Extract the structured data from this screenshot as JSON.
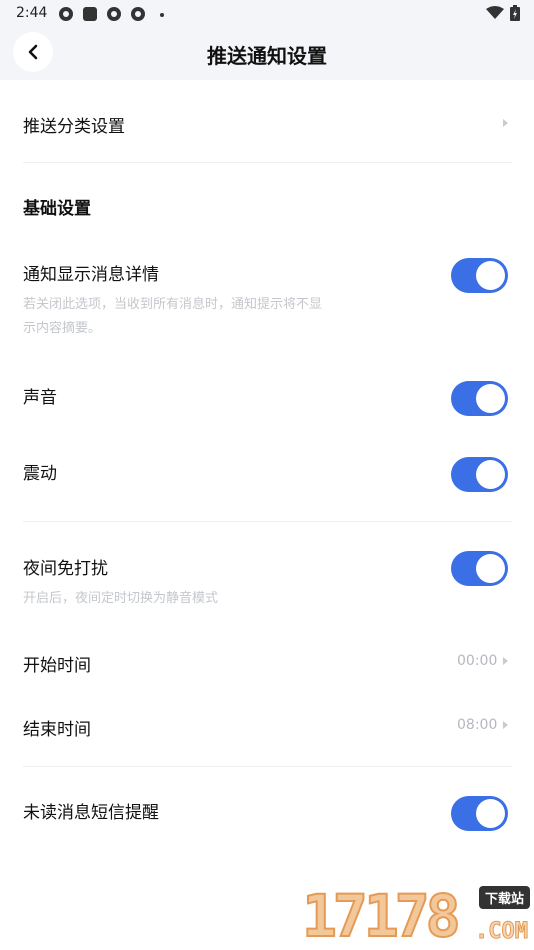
{
  "status_bar": {
    "time": "2:44",
    "icons": [
      "settings-gear-icon",
      "square-app-icon",
      "settings-gear-icon",
      "settings-gear-icon",
      "dot-icon"
    ],
    "right_icons": [
      "wifi-icon",
      "battery-charging-icon"
    ]
  },
  "header": {
    "title": "推送通知设置",
    "back_icon": "chevron-left-icon"
  },
  "rows": {
    "push_category": {
      "label": "推送分类设置"
    },
    "basic_section": {
      "title": "基础设置"
    },
    "show_details": {
      "label": "通知显示消息详情",
      "description": "若关闭此选项，当收到所有消息时，通知提示将不显示内容摘要。",
      "enabled": true
    },
    "sound": {
      "label": "声音",
      "enabled": true
    },
    "vibrate": {
      "label": "震动",
      "enabled": true
    },
    "night_dnd": {
      "label": "夜间免打扰",
      "description": "开启后，夜间定时切换为静音模式",
      "enabled": true
    },
    "start_time": {
      "label": "开始时间",
      "value": "00:00"
    },
    "end_time": {
      "label": "结束时间",
      "value": "08:00"
    },
    "sms_reminder": {
      "label": "未读消息短信提醒",
      "enabled": true
    }
  },
  "watermark": {
    "number": "17178",
    "badge": "下载站",
    "suffix": ".COM"
  },
  "colors": {
    "accent": "#3a6fe6",
    "header_bg": "#f4f5f8",
    "subtext": "#c4c7cc",
    "divider": "#eeeff1"
  }
}
